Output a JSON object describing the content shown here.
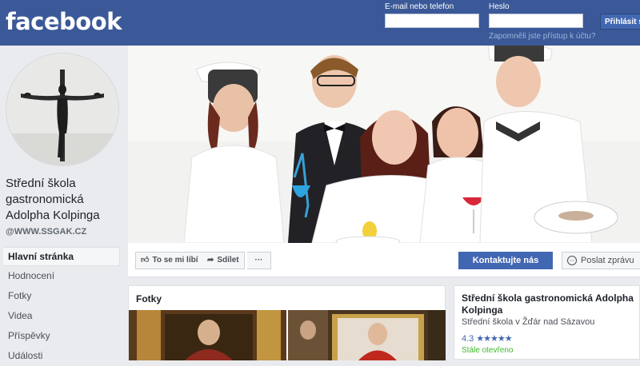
{
  "header": {
    "logo": "facebook",
    "email_label": "E-mail nebo telefon",
    "password_label": "Heslo",
    "email_value": "",
    "password_value": "",
    "forgot_link": "Zapomněli jste přístup k účtu?",
    "login_button": "Přihlásit se"
  },
  "sidebar": {
    "page_name": "Střední škola gastronomická Adolpha Kolpinga",
    "handle": "@WWW.SSGAK.CZ",
    "items": [
      {
        "label": "Hlavní stránka",
        "active": true
      },
      {
        "label": "Hodnocení"
      },
      {
        "label": "Fotky"
      },
      {
        "label": "Videa"
      },
      {
        "label": "Příspěvky"
      },
      {
        "label": "Události"
      }
    ]
  },
  "actions": {
    "like": "To se mi líbí",
    "share": "Sdílet",
    "more": "···",
    "contact": "Kontaktujte nás",
    "message": "Poslat zprávu"
  },
  "photos": {
    "title": "Fotky"
  },
  "info": {
    "name": "Střední škola gastronomická Adolpha Kolpinga",
    "subtitle": "Střední škola v Žďár nad Sázavou",
    "rating": "4.3",
    "stars": "★★★★★",
    "status": "Stále otevřeno"
  },
  "colors": {
    "brand": "#3b5998",
    "button": "#4267b2",
    "open": "#42b72a"
  }
}
